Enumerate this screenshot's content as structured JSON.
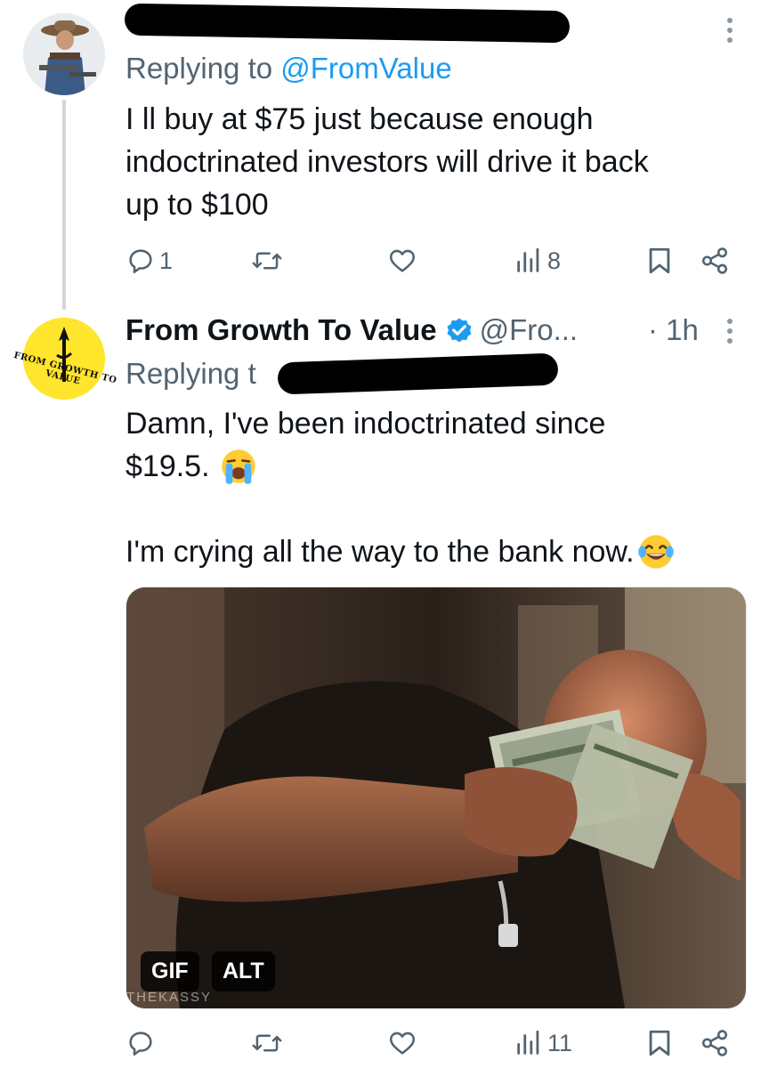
{
  "reply1": {
    "author_name_redacted": true,
    "replying_prefix": "Replying to ",
    "replying_handle": "@FromValue",
    "text_lines": [
      "I ll buy at $75 just because enough",
      "indoctrinated investors will drive it back",
      "up to $100"
    ],
    "actions": {
      "reply_count": "1",
      "retweet_count": "",
      "like_count": "",
      "views_count": "8"
    }
  },
  "reply2": {
    "author_name": "From Growth To Value",
    "verified": true,
    "handle": "@Fro...",
    "separator": "·",
    "time": "1h",
    "replying_prefix": "Replying t",
    "text_lines": [
      "Damn, I've been indoctrinated since",
      "$19.5."
    ],
    "text_line3": "I'm crying all the way to the bank now.",
    "emoji_1": "loudly-crying-face",
    "emoji_2": "face-with-tears-of-joy",
    "avatar_text": "FROM GROWTH TO VALUE",
    "media": {
      "gif_badge": "GIF",
      "alt_badge": "ALT",
      "watermark": "THEKASSY"
    },
    "actions": {
      "reply_count": "",
      "retweet_count": "",
      "like_count": "",
      "views_count": "11"
    }
  },
  "colors": {
    "link": "#1d9bf0",
    "muted": "#536471",
    "text": "#0f1419",
    "thread_line": "#cfd9de",
    "verified": "#1d9bf0",
    "avatar_yellow": "#ffe52c"
  },
  "icons": [
    "reply-icon",
    "retweet-icon",
    "like-icon",
    "views-icon",
    "bookmark-icon",
    "share-icon",
    "more-icon",
    "verified-badge-icon"
  ]
}
